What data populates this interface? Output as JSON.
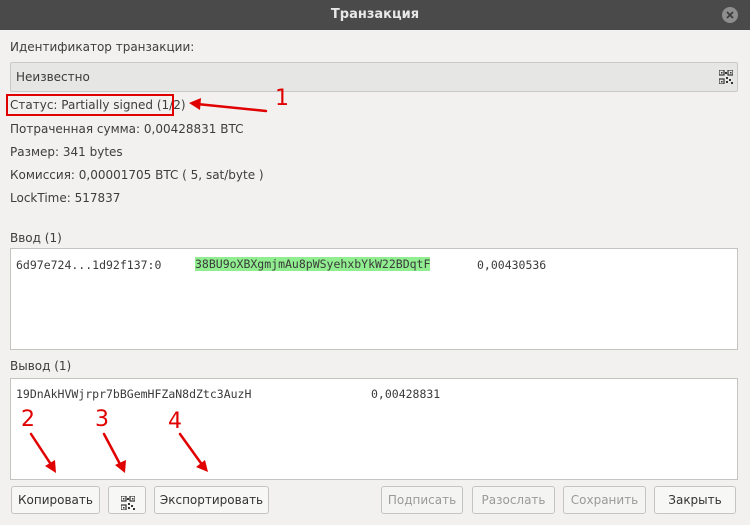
{
  "window": {
    "title": "Транзакция"
  },
  "tx_id": {
    "label": "Идентификатор транзакции:",
    "value": "Неизвестно"
  },
  "info": {
    "status": "Статус: Partially signed (1/2)",
    "amount": "Потраченная сумма: 0,00428831 BTC",
    "size": "Размер: 341 bytes",
    "fee": "Комиссия: 0,00001705 BTC  ( 5, sat/byte )",
    "locktime": "LockTime: 517837"
  },
  "inputs": {
    "label": "Ввод (1)",
    "rows": [
      {
        "prevout": "6d97e724...1d92f137:0",
        "address": "38BU9oXBXgmjmAu8pWSyehxbYkW22BDqtF",
        "amount": "0,00430536"
      }
    ]
  },
  "outputs": {
    "label": "Вывод (1)",
    "rows": [
      {
        "address": "19DnAkHVWjrpr7bBGemHFZaN8dZtc3AuzH",
        "amount": "0,00428831"
      }
    ]
  },
  "buttons": {
    "copy": "Копировать",
    "export": "Экспортировать",
    "sign": "Подписать",
    "broadcast": "Разослать",
    "save": "Сохранить",
    "close": "Закрыть"
  },
  "annotations": [
    "1",
    "2",
    "3",
    "4"
  ],
  "colors": {
    "titlebar": "#4a4a4a",
    "annotation": "#e00000",
    "address_highlight": "#90ee90"
  },
  "icons": {
    "window_close": "close-icon",
    "qr": "qr-code-icon"
  }
}
